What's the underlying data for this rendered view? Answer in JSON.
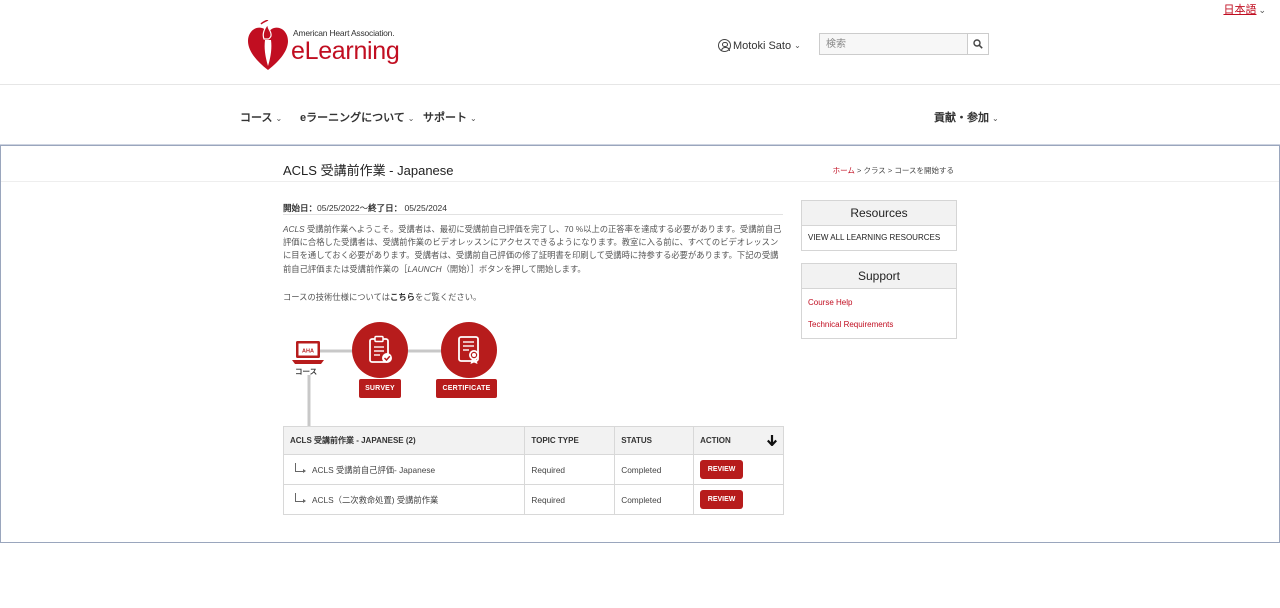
{
  "language": {
    "label": "日本語"
  },
  "brand": {
    "org": "American Heart Association.",
    "name": "eLearning"
  },
  "user": {
    "name": "Motoki Sato"
  },
  "search": {
    "placeholder": "検索"
  },
  "nav": {
    "items": [
      {
        "label": "コース"
      },
      {
        "label": "eラーニングについて"
      },
      {
        "label": "サポート"
      }
    ],
    "right": {
      "label": "貢献・参加"
    }
  },
  "page": {
    "title": "ACLS 受講前作業 - Japanese",
    "breadcrumb": {
      "home": "ホーム",
      "sep1": " > ",
      "classes": "クラス",
      "sep2": " > ",
      "current": "コースを開始する"
    }
  },
  "dates": {
    "start_label": "開始日：",
    "start": "05/25/2022",
    "sep": "〜",
    "end_label": "終了日：",
    "end": "05/25/2024"
  },
  "description": {
    "lead": "ACLS",
    "body": " 受講前作業へようこそ。受講者は、最初に受講前自己評価を完了し、70 %以上の正答率を達成する必要があります。受講前自己評価に合格した受講者は、受講前作業のビデオレッスンにアクセスできるようになります。教室に入る前に、すべてのビデオレッスンに目を通しておく必要があります。受講者は、受講前自己評価の修了証明書を印刷して受講時に持参する必要があります。下記の受講前自己評価または受講前作業の［",
    "launch": "LAUNCH",
    "tail": "（開始）］ボタンを押して開始します。"
  },
  "tech": {
    "pre": "コースの技術仕様については",
    "link": "こちら",
    "post": "をご覧ください。"
  },
  "diagram": {
    "laptop_text": "AHA",
    "laptop_label": "コース",
    "survey_label": "SURVEY",
    "certificate_label": "CERTIFICATE"
  },
  "table": {
    "headers": {
      "name": "ACLS 受講前作業 - JAPANESE (2)",
      "topic": "TOPIC TYPE",
      "status": "STATUS",
      "action": "ACTION"
    },
    "rows": [
      {
        "name": "ACLS 受講前自己評価- Japanese",
        "topic": "Required",
        "status": "Completed",
        "action": "REVIEW"
      },
      {
        "name": "ACLS（二次救命処置) 受講前作業",
        "topic": "Required",
        "status": "Completed",
        "action": "REVIEW"
      }
    ]
  },
  "resources": {
    "title": "Resources",
    "link": "VIEW ALL LEARNING RESOURCES"
  },
  "support": {
    "title": "Support",
    "links": [
      "Course Help",
      "Technical Requirements"
    ]
  },
  "colors": {
    "brand_red": "#c10e21",
    "button_red": "#b71c1c"
  }
}
